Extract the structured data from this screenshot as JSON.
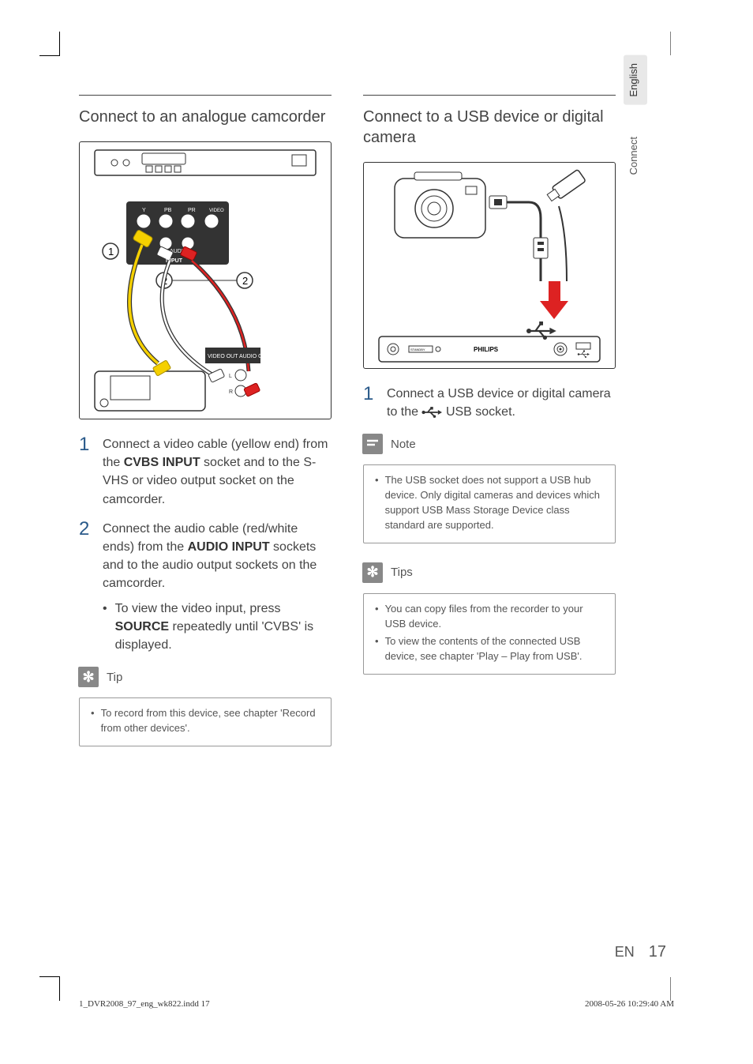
{
  "sideTabs": {
    "lang": "English",
    "section": "Connect"
  },
  "left": {
    "heading": "Connect to an analogue camcorder",
    "illustration": {
      "labels": {
        "c1": "1",
        "c2a": "2",
        "c2b": "2"
      },
      "portGroup": {
        "y": "Y",
        "pb": "PB",
        "pr": "PR",
        "video": "VIDEO",
        "audio": "AUDIO",
        "input": "INPUT"
      },
      "camcorder": {
        "video": "VIDEO OUT",
        "audio": "AUDIO OUT",
        "l": "L",
        "r": "R"
      }
    },
    "steps": [
      {
        "num": "1",
        "text_pre": "Connect a video cable (yellow end) from the ",
        "bold1": "CVBS INPUT",
        "text_mid": " socket and to the S-VHS or video output socket on the camcorder."
      },
      {
        "num": "2",
        "text_pre": "Connect the audio cable (red/white ends) from the ",
        "bold1": "AUDIO INPUT",
        "text_mid": " sockets and to the audio output sockets on the camcorder.",
        "sub": {
          "text_pre": "To view the video input, press ",
          "bold1": "SOURCE",
          "text_post": " repeatedly until 'CVBS' is displayed."
        }
      }
    ],
    "tip": {
      "title": "Tip",
      "items": [
        "To record from this device, see chapter 'Record from other devices'."
      ]
    }
  },
  "right": {
    "heading": "Connect to a USB device or digital camera",
    "illustration": {
      "brand": "PHILIPS",
      "standby": "STANDBY"
    },
    "steps": [
      {
        "num": "1",
        "text_pre": "Connect a USB device or digital camera to the ",
        "text_post": " USB socket."
      }
    ],
    "note": {
      "title": "Note",
      "items": [
        "The USB socket does not support a USB hub device. Only digital cameras and devices which support USB Mass Storage Device class standard are supported."
      ]
    },
    "tips": {
      "title": "Tips",
      "items": [
        "You can copy files from the recorder to your USB device.",
        "To view the contents of the connected USB device, see chapter 'Play – Play from USB'."
      ]
    }
  },
  "footer": {
    "lang": "EN",
    "page": "17"
  },
  "printInfo": {
    "file": "1_DVR2008_97_eng_wk822.indd   17",
    "timestamp": "2008-05-26   10:29:40 AM"
  }
}
